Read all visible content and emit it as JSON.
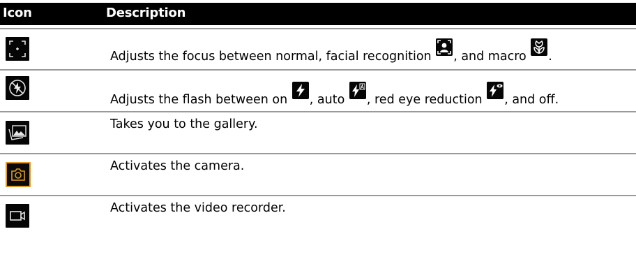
{
  "header": {
    "icon_col": "Icon",
    "desc_col": "Description"
  },
  "rows": [
    {
      "icon": "focus-frame-icon",
      "desc_parts": [
        "Adjusts the focus between normal, facial recognition ",
        ", and macro ",
        "."
      ],
      "inline_icons": [
        "face-focus-icon",
        "macro-flower-icon"
      ]
    },
    {
      "icon": "flash-off-icon",
      "desc_parts": [
        "Adjusts the flash between on ",
        ", auto ",
        ", red eye reduction ",
        ", and off."
      ],
      "inline_icons": [
        "flash-on-icon",
        "flash-auto-icon",
        "flash-red-eye-icon"
      ]
    },
    {
      "icon": "gallery-icon",
      "desc": "Takes you to the gallery."
    },
    {
      "icon": "camera-icon",
      "desc": "Activates the camera."
    },
    {
      "icon": "video-recorder-icon",
      "desc": "Activates the video recorder."
    }
  ],
  "colors": {
    "header_bg": "#000000",
    "header_text": "#ffffff",
    "divider": "#9a9a9a",
    "camera_accent": "#e09a24"
  }
}
